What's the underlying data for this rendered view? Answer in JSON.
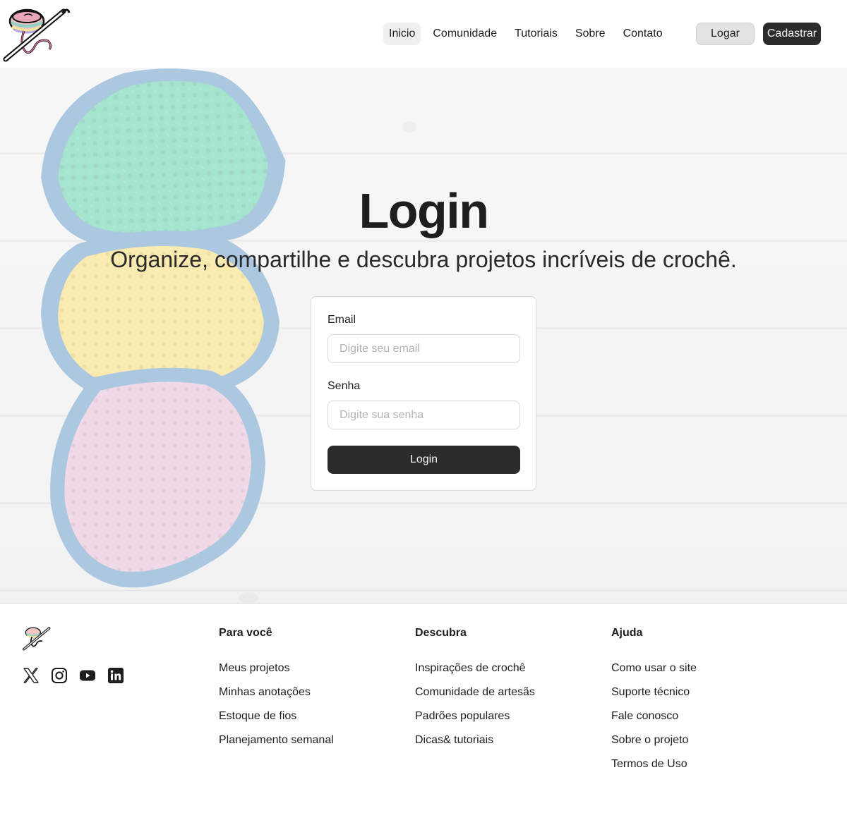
{
  "header": {
    "logo_icon": "crochet-yarn-hook-logo-icon",
    "nav": [
      {
        "label": "Inicio",
        "active": true
      },
      {
        "label": "Comunidade",
        "active": false
      },
      {
        "label": "Tutoriais",
        "active": false
      },
      {
        "label": "Sobre",
        "active": false
      },
      {
        "label": "Contato",
        "active": false
      }
    ],
    "login_button": "Logar",
    "signup_button": "Cadastrar"
  },
  "hero": {
    "title": "Login",
    "subtitle": "Organize, compartilhe e descubra projetos incríveis de crochê.",
    "background_image": "crochet-granny-squares-on-white-wood",
    "form": {
      "email_label": "Email",
      "email_placeholder": "Digite seu email",
      "email_value": "",
      "password_label": "Senha",
      "password_placeholder": "Digite sua senha",
      "password_value": "",
      "submit_label": "Login"
    }
  },
  "footer": {
    "logo_icon": "crochet-yarn-hook-logo-icon",
    "socials": [
      {
        "icon": "x-twitter-icon"
      },
      {
        "icon": "instagram-icon"
      },
      {
        "icon": "youtube-icon"
      },
      {
        "icon": "linkedin-icon"
      }
    ],
    "columns": [
      {
        "title": "Para você",
        "links": [
          "Meus projetos",
          "Minhas anotações",
          "Estoque de fios",
          "Planejamento semanal"
        ]
      },
      {
        "title": "Descubra",
        "links": [
          "Inspirações de crochê",
          "Comunidade de artesãs",
          "Padrões populares",
          "Dicas& tutoriais"
        ]
      },
      {
        "title": "Ajuda",
        "links": [
          "Como usar o site",
          "Suporte técnico",
          "Fale conosco",
          "Sobre o projeto",
          "Termos de Uso"
        ]
      }
    ]
  },
  "colors": {
    "primary_dark": "#2c2c2c",
    "secondary_button": "#e3e3e3",
    "nav_active_bg": "#f0f0f0",
    "text": "#1e1e1e",
    "placeholder": "#b3b3b3",
    "border": "#d9d9d9"
  }
}
